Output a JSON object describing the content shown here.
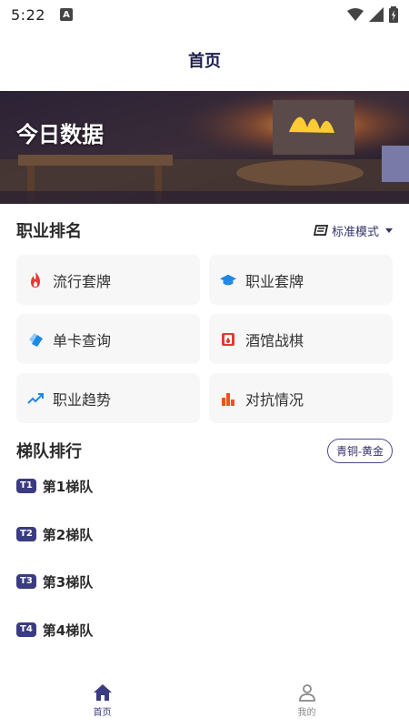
{
  "status": {
    "time": "5:22",
    "notification": "A"
  },
  "header": {
    "title": "首页"
  },
  "banner": {
    "title": "今日数据"
  },
  "class_ranking": {
    "title": "职业排名",
    "mode_label": "标准模式",
    "cards": [
      {
        "label": "流行套牌",
        "icon": "fire-icon",
        "color": "#e53935"
      },
      {
        "label": "职业套牌",
        "icon": "graduation-cap-icon",
        "color": "#1e88e5"
      },
      {
        "label": "单卡查询",
        "icon": "cards-icon",
        "color": "#1e88e5"
      },
      {
        "label": "酒馆战棋",
        "icon": "tavern-icon",
        "color": "#e53935"
      },
      {
        "label": "职业趋势",
        "icon": "trend-up-icon",
        "color": "#1e88e5"
      },
      {
        "label": "对抗情况",
        "icon": "bar-chart-icon",
        "color": "#f4511e"
      }
    ]
  },
  "tier_ranking": {
    "title": "梯队排行",
    "rank_button": "青铜-黄金",
    "tiers": [
      {
        "badge": "T1",
        "label": "第1梯队"
      },
      {
        "badge": "T2",
        "label": "第2梯队"
      },
      {
        "badge": "T3",
        "label": "第3梯队"
      },
      {
        "badge": "T4",
        "label": "第4梯队"
      }
    ]
  },
  "nav": {
    "home": "首页",
    "mine": "我的",
    "active_color": "#3b3b82",
    "inactive_color": "#888888"
  }
}
